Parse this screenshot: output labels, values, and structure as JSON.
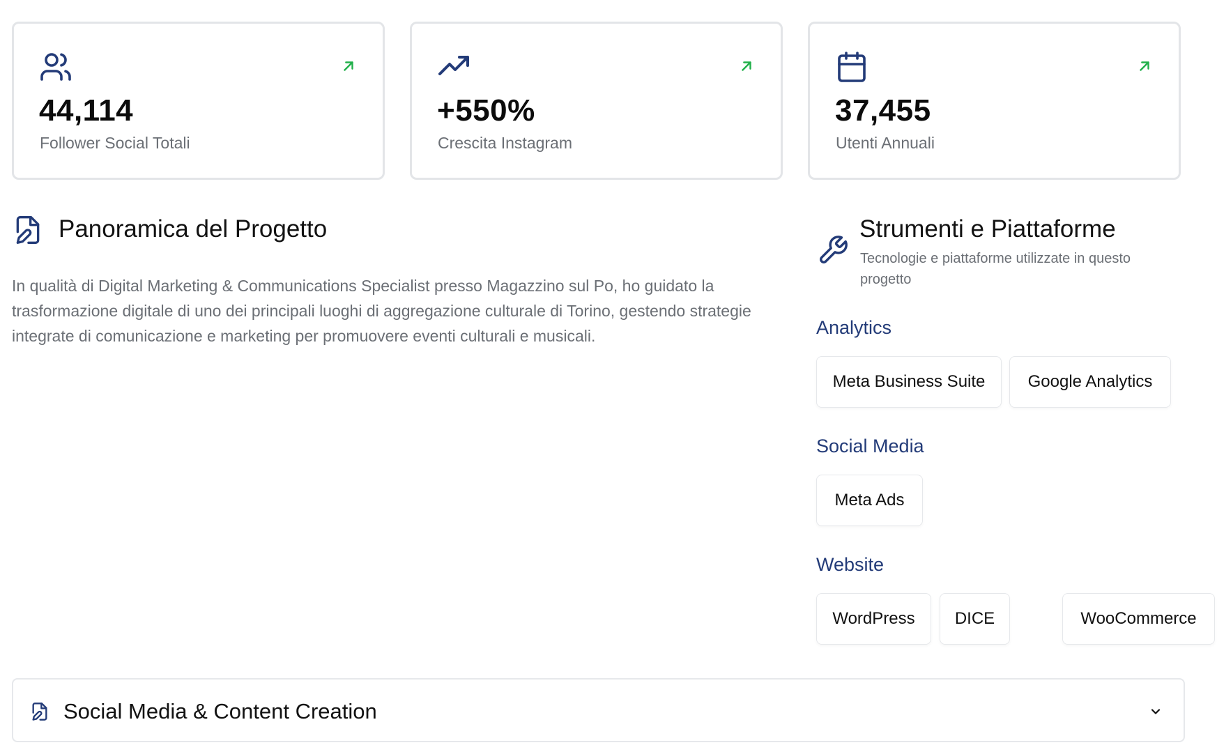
{
  "stats": [
    {
      "value": "44,114",
      "label": "Follower Social Totali",
      "icon": "users-icon"
    },
    {
      "value": "+550%",
      "label": "Crescita Instagram",
      "icon": "trending-up-icon"
    },
    {
      "value": "37,455",
      "label": "Utenti Annuali",
      "icon": "calendar-icon"
    }
  ],
  "overview": {
    "title": "Panoramica del Progetto",
    "text": "In qualità di Digital Marketing & Communications Specialist presso Magazzino sul Po, ho guidato la trasformazione digitale di uno dei principali luoghi di aggregazione culturale di Torino, gestendo strategie integrate di comunicazione e marketing per promuovere eventi culturali e musicali."
  },
  "tools": {
    "title": "Strumenti e Piattaforme",
    "subtitle": "Tecnologie e piattaforme utilizzate in questo progetto",
    "categories": [
      {
        "name": "Analytics",
        "items": [
          "Meta Business Suite",
          "Google Analytics"
        ]
      },
      {
        "name": "Social Media",
        "items": [
          "Meta Ads"
        ]
      },
      {
        "name": "Website",
        "items": [
          "WordPress",
          "DICE",
          "WooCommerce"
        ]
      }
    ]
  },
  "accordion": {
    "title": "Social Media & Content Creation"
  },
  "colors": {
    "navy": "#233b78",
    "green_arrow": "#22b04b",
    "muted_text": "#6b6f75"
  }
}
